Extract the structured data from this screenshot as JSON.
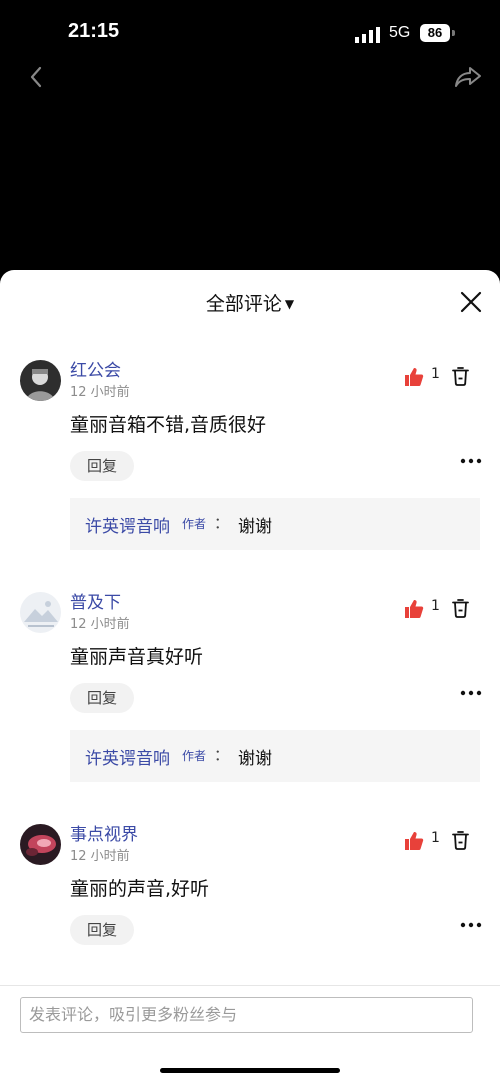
{
  "status": {
    "time": "21:15",
    "network": "5G",
    "battery": "86"
  },
  "sheet": {
    "title": "全部评论"
  },
  "comments": [
    {
      "user": "红公会",
      "time": "12 小时前",
      "text": "童丽音箱不错,音质很好",
      "likes": "1",
      "reply_label": "回复",
      "sub_reply": {
        "user": "许英谔音响",
        "tag": "作者",
        "colon": "：",
        "text": "谢谢"
      }
    },
    {
      "user": "普及下",
      "time": "12 小时前",
      "text": "童丽声音真好听",
      "likes": "1",
      "reply_label": "回复",
      "sub_reply": {
        "user": "许英谔音响",
        "tag": "作者",
        "colon": "：",
        "text": "谢谢"
      }
    },
    {
      "user": "事点视界",
      "time": "12 小时前",
      "text": "童丽的声音,好听",
      "likes": "1",
      "reply_label": "回复"
    }
  ],
  "input": {
    "placeholder": "发表评论，吸引更多粉丝参与"
  },
  "colors": {
    "accent": "#3b4aa6",
    "like": "#e8413a"
  }
}
